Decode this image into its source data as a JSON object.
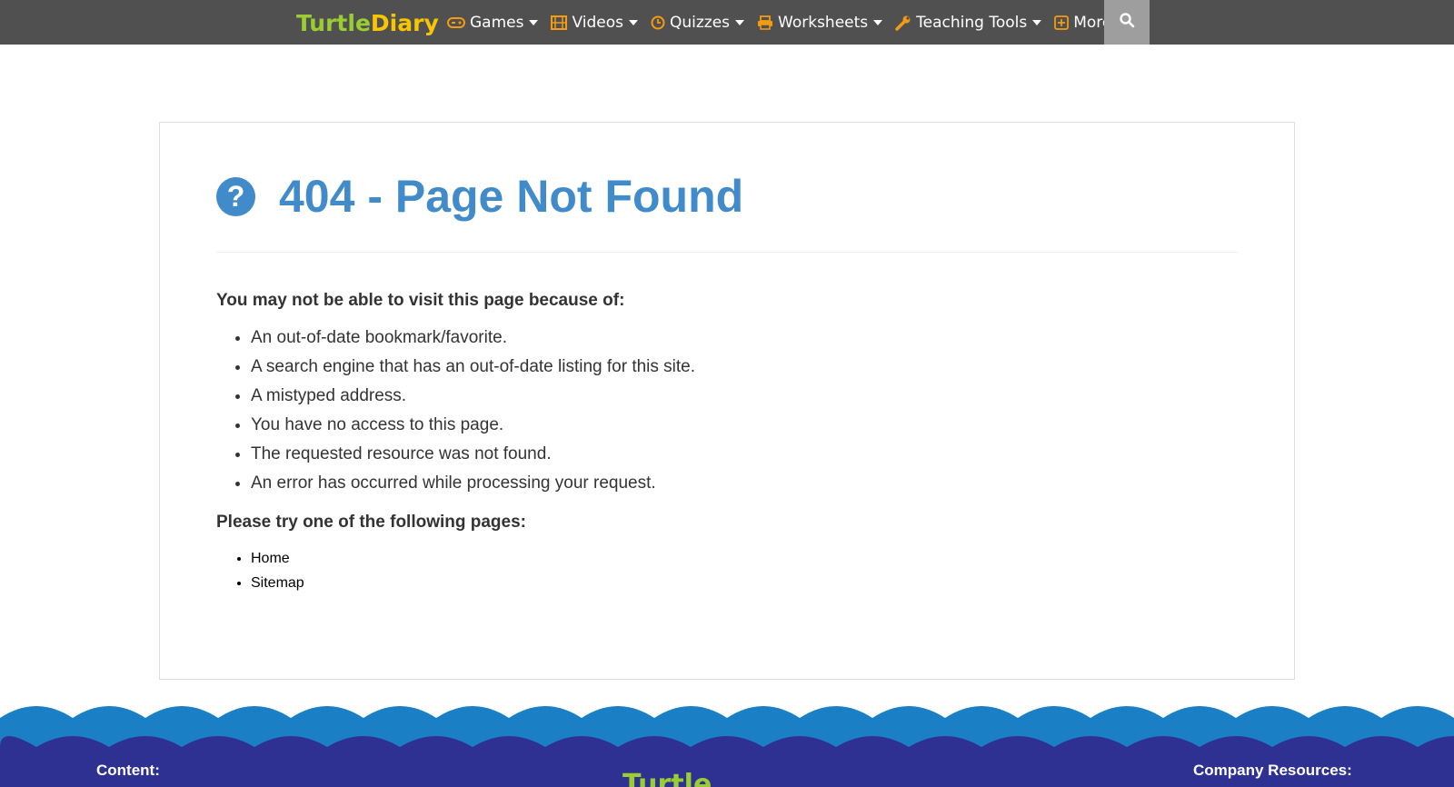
{
  "nav": {
    "logo_part1": "Turtle",
    "logo_part2": "Diary",
    "items": [
      {
        "label": "Games",
        "icon": "gamepad-icon"
      },
      {
        "label": "Videos",
        "icon": "film-icon"
      },
      {
        "label": "Quizzes",
        "icon": "clock-icon"
      },
      {
        "label": "Worksheets",
        "icon": "printer-icon"
      },
      {
        "label": "Teaching Tools",
        "icon": "wrench-icon"
      },
      {
        "label": "More",
        "icon": "plus-square-icon"
      }
    ],
    "search_icon": "search-icon",
    "background": "#505050",
    "icon_color": "#f39c12"
  },
  "main": {
    "title_icon": "question-circle-icon",
    "title": "404 - Page Not Found",
    "reasons_heading": "You may not be able to visit this page because of:",
    "reasons": [
      "An out-of-date bookmark/favorite.",
      "A search engine that has an out-of-date listing for this site.",
      "A mistyped address.",
      "You have no access to this page.",
      "The requested resource was not found.",
      "An error has occurred while processing your request."
    ],
    "try_heading": "Please try one of the following pages:",
    "links": [
      "Home",
      "Sitemap"
    ],
    "accent": "#428bca"
  },
  "footer": {
    "content_label": "Content:",
    "company_label": "Company Resources:",
    "logo_part1": "Turtle",
    "wave_light": "#1a7fc4",
    "wave_dark": "#2e3192"
  }
}
